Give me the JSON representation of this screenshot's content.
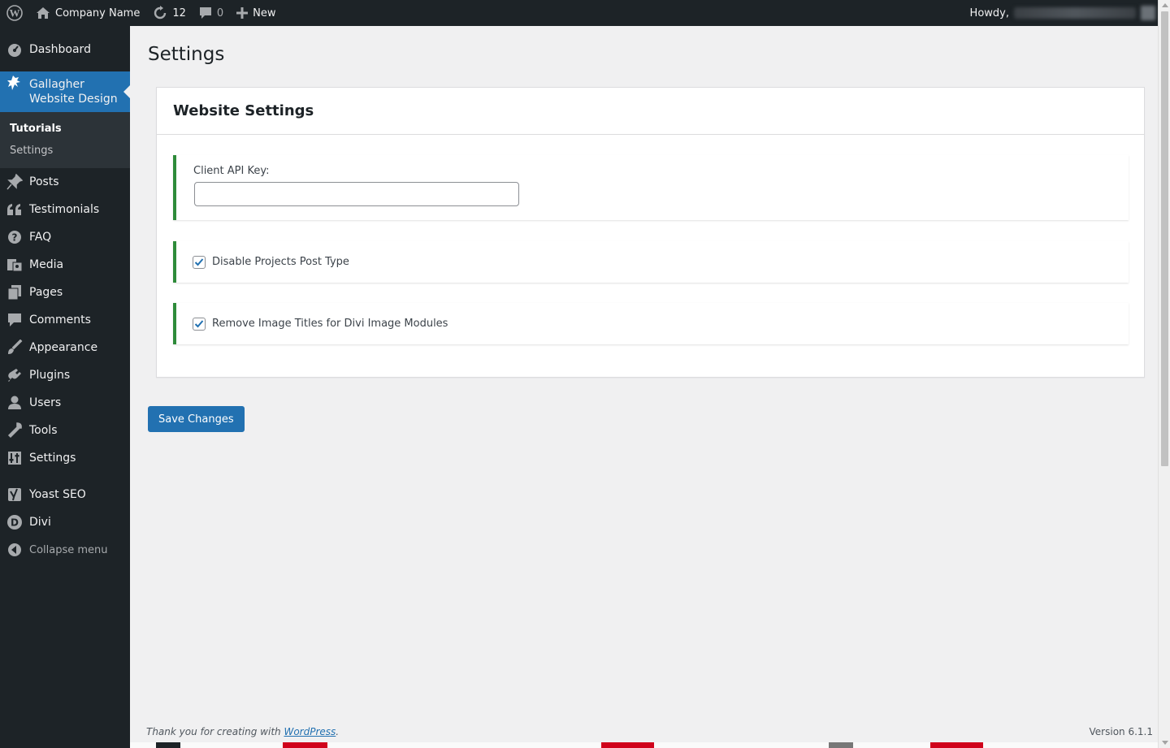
{
  "adminbar": {
    "site_name": "Company Name",
    "updates_count": "12",
    "comments_count": "0",
    "new_label": "New",
    "howdy": "Howdy,"
  },
  "sidebar": {
    "items": [
      {
        "label": "Dashboard",
        "icon": "dashboard-icon"
      },
      {
        "label": "Gallagher Website Design",
        "icon": "lion-icon"
      },
      {
        "label": "Posts",
        "icon": "pin-icon"
      },
      {
        "label": "Testimonials",
        "icon": "quote-icon"
      },
      {
        "label": "FAQ",
        "icon": "help-icon"
      },
      {
        "label": "Media",
        "icon": "media-icon"
      },
      {
        "label": "Pages",
        "icon": "pages-icon"
      },
      {
        "label": "Comments",
        "icon": "comment-icon"
      },
      {
        "label": "Appearance",
        "icon": "brush-icon"
      },
      {
        "label": "Plugins",
        "icon": "plug-icon"
      },
      {
        "label": "Users",
        "icon": "user-icon"
      },
      {
        "label": "Tools",
        "icon": "wrench-icon"
      },
      {
        "label": "Settings",
        "icon": "settings-icon"
      },
      {
        "label": "Yoast SEO",
        "icon": "yoast-icon"
      },
      {
        "label": "Divi",
        "icon": "divi-icon"
      },
      {
        "label": "Collapse menu",
        "icon": "collapse-icon"
      }
    ],
    "submenu": [
      {
        "label": "Tutorials",
        "active": true
      },
      {
        "label": "Settings",
        "active": false
      }
    ]
  },
  "main": {
    "page_title": "Settings",
    "card_title": "Website Settings",
    "api_key_label": "Client API Key:",
    "api_key_value": "",
    "option_disable_projects": {
      "label": "Disable Projects Post Type",
      "checked": true
    },
    "option_remove_titles": {
      "label": "Remove Image Titles for Divi Image Modules",
      "checked": true
    },
    "save_button": "Save Changes"
  },
  "footer": {
    "thanks_prefix": "Thank you for creating with ",
    "thanks_link": "WordPress",
    "thanks_suffix": ".",
    "version": "Version 6.1.1"
  },
  "colors": {
    "adminbar_bg": "#1d2327",
    "accent": "#2271b1",
    "field_border": "#2e8b3a",
    "content_bg": "#f0f0f1"
  }
}
